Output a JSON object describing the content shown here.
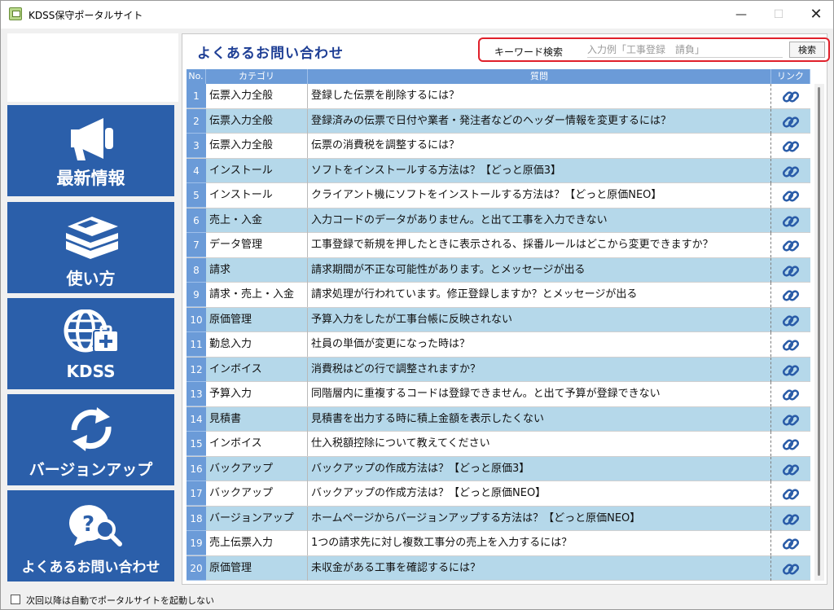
{
  "window": {
    "title": "KDSS保守ポータルサイト",
    "min": "—",
    "max": "☐",
    "close": "✕"
  },
  "nav": [
    {
      "label": "最新情報",
      "icon": "megaphone-icon"
    },
    {
      "label": "使い方",
      "icon": "books-icon"
    },
    {
      "label": "KDSS",
      "icon": "globe-medical-icon"
    },
    {
      "label": "バージョンアップ",
      "icon": "refresh-icon"
    },
    {
      "label": "よくあるお問い合わせ",
      "icon": "question-search-icon"
    }
  ],
  "main": {
    "title": "よくあるお問い合わせ",
    "search": {
      "label": "キーワード検索",
      "placeholder": "入力例「工事登録　請負」",
      "button": "検索"
    }
  },
  "table": {
    "headers": {
      "no": "No.",
      "category": "カテゴリ",
      "question": "質問",
      "link": "リンク"
    },
    "rows": [
      {
        "no": "1",
        "category": "伝票入力全般",
        "question": "登録した伝票を削除するには？"
      },
      {
        "no": "2",
        "category": "伝票入力全般",
        "question": "登録済みの伝票で日付や業者・発注者などのヘッダー情報を変更するには？"
      },
      {
        "no": "3",
        "category": "伝票入力全般",
        "question": "伝票の消費税を調整するには？"
      },
      {
        "no": "4",
        "category": "インストール",
        "question": "ソフトをインストールする方法は？【どっと原価3】"
      },
      {
        "no": "5",
        "category": "インストール",
        "question": "クライアント機にソフトをインストールする方法は？【どっと原価NEO】"
      },
      {
        "no": "6",
        "category": "売上・入金",
        "question": "入力コードのデータがありません。と出て工事を入力できない"
      },
      {
        "no": "7",
        "category": "データ管理",
        "question": "工事登録で新規を押したときに表示される、採番ルールはどこから変更できますか？"
      },
      {
        "no": "8",
        "category": "請求",
        "question": "請求期間が不正な可能性があります。とメッセージが出る"
      },
      {
        "no": "9",
        "category": "請求・売上・入金",
        "question": "請求処理が行われています。修正登録しますか？とメッセージが出る"
      },
      {
        "no": "10",
        "category": "原価管理",
        "question": "予算入力をしたが工事台帳に反映されない"
      },
      {
        "no": "11",
        "category": "勤怠入力",
        "question": "社員の単価が変更になった時は？"
      },
      {
        "no": "12",
        "category": "インボイス",
        "question": "消費税はどの行で調整されますか？"
      },
      {
        "no": "13",
        "category": "予算入力",
        "question": "同階層内に重複するコードは登録できません。と出て予算が登録できない"
      },
      {
        "no": "14",
        "category": "見積書",
        "question": "見積書を出力する時に積上金額を表示したくない"
      },
      {
        "no": "15",
        "category": "インボイス",
        "question": "仕入税額控除について教えてください"
      },
      {
        "no": "16",
        "category": "バックアップ",
        "question": "バックアップの作成方法は？【どっと原価3】"
      },
      {
        "no": "17",
        "category": "バックアップ",
        "question": "バックアップの作成方法は？【どっと原価NEO】"
      },
      {
        "no": "18",
        "category": "バージョンアップ",
        "question": "ホームページからバージョンアップする方法は？【どっと原価NEO】"
      },
      {
        "no": "19",
        "category": "売上伝票入力",
        "question": "1つの請求先に対し複数工事分の売上を入力するには？"
      },
      {
        "no": "20",
        "category": "原価管理",
        "question": "未収金がある工事を確認するには？"
      }
    ]
  },
  "footer": {
    "checkbox_label": "次回以降は自動でポータルサイトを起動しない"
  },
  "colors": {
    "nav_bg": "#2b5faa",
    "header_bg": "#6b9bd8",
    "alt_row": "#b5d8ea",
    "title": "#1f3f95",
    "search_border": "#e0202a",
    "link_icon": "#2a5ca8"
  }
}
